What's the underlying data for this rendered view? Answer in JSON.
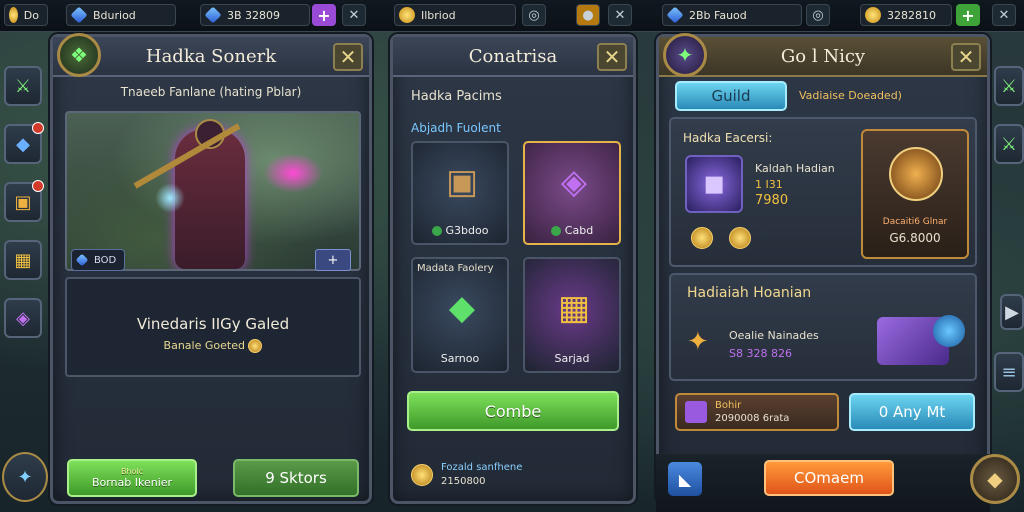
{
  "topbar": {
    "panel1": {
      "avatar_label": "Do",
      "currency_value": "Bduriod"
    },
    "panel1b": {
      "currency_value": "3B 32809"
    },
    "panel2": {
      "currency_value": "Ilbriod"
    },
    "panel3": {
      "currency_value": "2Bb Fauod",
      "gold_value": "3282810"
    }
  },
  "panel_left": {
    "title": "Hadka Sonerk",
    "subtitle": "Tnaeeb Fanlane (hating Pblar)",
    "hero_tag": "BOD",
    "hero_name": "Vinedaris IIGy Galed",
    "hero_sub": "Banale Goeted",
    "btn_left": "Bornab Ikenier",
    "btn_left_small": "Bholc",
    "btn_right": "9 Sktors"
  },
  "panel_mid": {
    "title": "Conatrisa",
    "section_title": "Hadka Pacims",
    "tab_label": "Abjadh Fuolent",
    "slots": [
      {
        "label": "G3bdoo",
        "top": ""
      },
      {
        "label": "Cabd",
        "top": ""
      },
      {
        "label": "Sarnoo",
        "top": "Madata Faolery"
      },
      {
        "label": "Sarjad",
        "top": ""
      }
    ],
    "combine_button": "Combe",
    "footer_line1": "Fozald sanfhene",
    "footer_line2": "2150800"
  },
  "panel_right": {
    "title": "Go l Nicy",
    "tab_guild": "Guild",
    "tab_other": "Vadiaise Doeaded)",
    "card_title": "Hadka Eacersi:",
    "item_name": "Kaldah Hadian",
    "item_count": "1 I31",
    "item_price": "7980",
    "reward_caption": "Dacaiti6 Glnar",
    "reward_value": "G6.8000",
    "section2_title": "Hadiaiah Hoanian",
    "section2_line1": "Oealie Nainades",
    "section2_line2": "S8 328 826",
    "bottom_left_line1": "Bohir",
    "bottom_left_line2": "2090008 6rata",
    "buy_button": "0 Any Mt",
    "confirm_button": "COmaem"
  }
}
